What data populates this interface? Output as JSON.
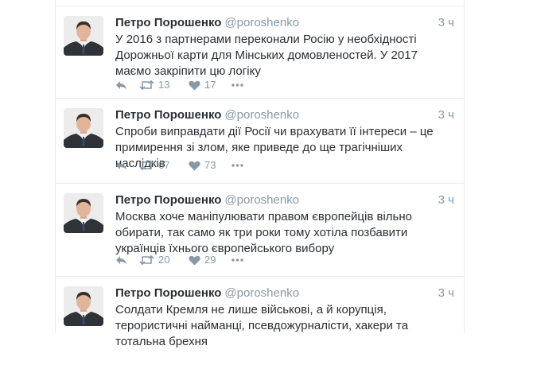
{
  "tweets": [
    {
      "name": "Петро Порошенко",
      "handle": "@poroshenko",
      "time": "3 ч",
      "text": "У 2016 з партнерами переконали Росію у необхідності Дорожньої карти для Мінських домовленостей. У 2017 маємо закріпити цю логіку",
      "retweets": "13",
      "likes": "17"
    },
    {
      "name": "Петро Порошенко",
      "handle": "@poroshenko",
      "time": "3 ч",
      "text": "Спроби виправдати дії Росії чи врахувати її інтереси – це примирення зі злом, яке приведе до ще трагічніших наслідків",
      "retweets": "67",
      "likes": "73"
    },
    {
      "name": "Петро Порошенко",
      "handle": "@poroshenko",
      "time": "3 ч",
      "text": "Москва хоче маніпулювати правом європейців вільно обирати, так само як три роки тому хотіла позбавити українців їхнього європейського вибору",
      "retweets": "20",
      "likes": "29"
    },
    {
      "name": "Петро Порошенко",
      "handle": "@poroshenko",
      "time": "3 ч",
      "text": "Солдати Кремля не лише військові, а й корупція, терористичні найманці, псевдожурналісти, хакери та тотальна брехня"
    }
  ],
  "icons": {
    "reply": "reply-icon",
    "retweet": "retweet-icon",
    "like": "heart-icon",
    "more": "more-icon"
  },
  "colors": {
    "text": "#292f33",
    "muted": "#8899a6",
    "divider": "#e6ecf0"
  }
}
